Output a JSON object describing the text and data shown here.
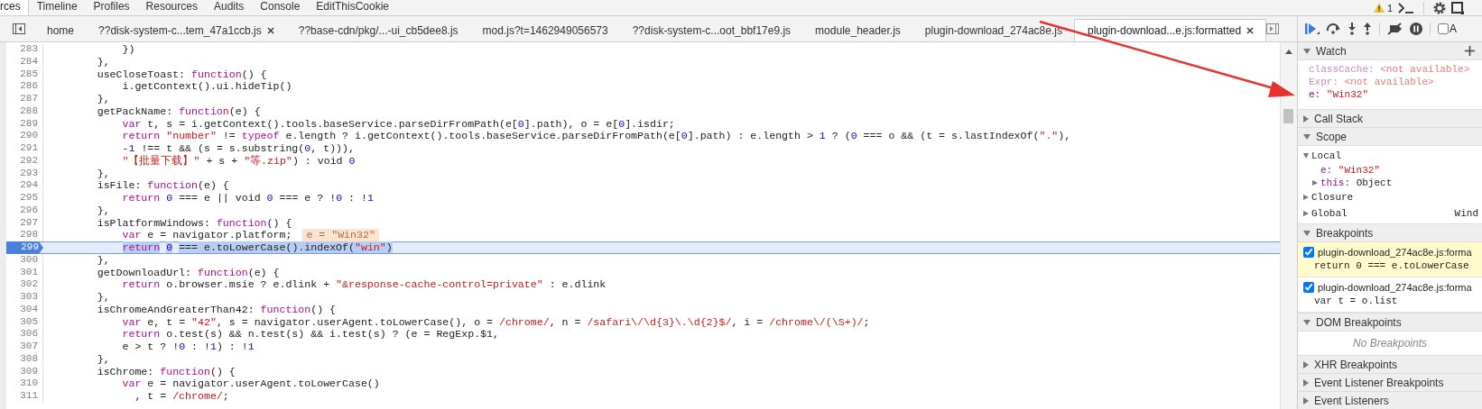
{
  "panel_tabs": [
    {
      "label": "rces",
      "selected": true
    },
    {
      "label": "Timeline",
      "selected": false
    },
    {
      "label": "Profiles",
      "selected": false
    },
    {
      "label": "Resources",
      "selected": false
    },
    {
      "label": "Audits",
      "selected": false
    },
    {
      "label": "Console",
      "selected": false
    },
    {
      "label": "EditThisCookie",
      "selected": false
    }
  ],
  "warnings": {
    "count": "1"
  },
  "file_tabs": [
    {
      "label": "home",
      "selected": false,
      "closable": false
    },
    {
      "label": "??disk-system-c...tem_47a1ccb.js",
      "selected": false,
      "closable": true
    },
    {
      "label": "??base-cdn/pkg/...-ui_cb5dee8.js",
      "selected": false,
      "closable": false
    },
    {
      "label": "mod.js?t=1462949056573",
      "selected": false,
      "closable": false
    },
    {
      "label": "??disk-system-c...oot_bbf17e9.js",
      "selected": false,
      "closable": false
    },
    {
      "label": "module_header.js",
      "selected": false,
      "closable": false
    },
    {
      "label": "plugin-download_274ac8e.js",
      "selected": false,
      "closable": false
    },
    {
      "label": "plugin-download...e.js:formatted",
      "selected": true,
      "closable": true
    }
  ],
  "debugger_toolbar": {
    "async_label": "A",
    "async_checked": false
  },
  "code": {
    "lines": [
      {
        "number": "283",
        "current": false,
        "selected": false,
        "tokens": [
          {
            "kind": "plain",
            "text": "            })"
          }
        ]
      },
      {
        "number": "284",
        "current": false,
        "selected": false,
        "tokens": [
          {
            "kind": "plain",
            "text": "        },"
          }
        ]
      },
      {
        "number": "285",
        "current": false,
        "selected": false,
        "tokens": [
          {
            "kind": "plain",
            "text": "        useCloseToast: "
          },
          {
            "kind": "keyword",
            "text": "function"
          },
          {
            "kind": "plain",
            "text": "() {"
          }
        ]
      },
      {
        "number": "286",
        "current": false,
        "selected": false,
        "tokens": [
          {
            "kind": "plain",
            "text": "            i.getContext().ui.hideTip()"
          }
        ]
      },
      {
        "number": "287",
        "current": false,
        "selected": false,
        "tokens": [
          {
            "kind": "plain",
            "text": "        },"
          }
        ]
      },
      {
        "number": "288",
        "current": false,
        "selected": false,
        "tokens": [
          {
            "kind": "plain",
            "text": "        getPackName: "
          },
          {
            "kind": "keyword",
            "text": "function"
          },
          {
            "kind": "plain",
            "text": "(e) {"
          }
        ]
      },
      {
        "number": "289",
        "current": false,
        "selected": false,
        "tokens": [
          {
            "kind": "keyword",
            "text": "            var"
          },
          {
            "kind": "plain",
            "text": " t, s = i.getContext().tools.baseService.parseDirFromPath(e["
          },
          {
            "kind": "number",
            "text": "0"
          },
          {
            "kind": "plain",
            "text": "].path), o = e["
          },
          {
            "kind": "number",
            "text": "0"
          },
          {
            "kind": "plain",
            "text": "].isdir;"
          }
        ]
      },
      {
        "number": "290",
        "current": false,
        "selected": false,
        "tokens": [
          {
            "kind": "keyword",
            "text": "            return"
          },
          {
            "kind": "string",
            "text": " \"number\""
          },
          {
            "kind": "plain",
            "text": " != "
          },
          {
            "kind": "keyword",
            "text": "typeof"
          },
          {
            "kind": "plain",
            "text": " e.length ? i.getContext().tools.baseService.parseDirFromPath(e["
          },
          {
            "kind": "number",
            "text": "0"
          },
          {
            "kind": "plain",
            "text": "].path) : e.length > "
          },
          {
            "kind": "number",
            "text": "1"
          },
          {
            "kind": "plain",
            "text": " ? ("
          },
          {
            "kind": "number",
            "text": "0"
          },
          {
            "kind": "plain",
            "text": " === o && (t = s.lastIndexOf("
          },
          {
            "kind": "string",
            "text": "\".\""
          },
          {
            "kind": "plain",
            "text": "),"
          }
        ]
      },
      {
        "number": "291",
        "current": false,
        "selected": false,
        "tokens": [
          {
            "kind": "number",
            "text": "            -1"
          },
          {
            "kind": "plain",
            "text": " !== t && (s = s.substring("
          },
          {
            "kind": "number",
            "text": "0"
          },
          {
            "kind": "plain",
            "text": ", t))),"
          }
        ]
      },
      {
        "number": "292",
        "current": false,
        "selected": false,
        "tokens": [
          {
            "kind": "string",
            "text": "            \"【批量下载】\""
          },
          {
            "kind": "plain",
            "text": " + s + "
          },
          {
            "kind": "string",
            "text": "\"等.zip\""
          },
          {
            "kind": "plain",
            "text": ") : void "
          },
          {
            "kind": "number",
            "text": "0"
          }
        ]
      },
      {
        "number": "293",
        "current": false,
        "selected": false,
        "tokens": [
          {
            "kind": "plain",
            "text": "        },"
          }
        ]
      },
      {
        "number": "294",
        "current": false,
        "selected": false,
        "tokens": [
          {
            "kind": "plain",
            "text": "        isFile: "
          },
          {
            "kind": "keyword",
            "text": "function"
          },
          {
            "kind": "plain",
            "text": "(e) {"
          }
        ]
      },
      {
        "number": "295",
        "current": false,
        "selected": false,
        "tokens": [
          {
            "kind": "keyword",
            "text": "            return"
          },
          {
            "kind": "number",
            "text": " 0"
          },
          {
            "kind": "plain",
            "text": " === e || void "
          },
          {
            "kind": "number",
            "text": "0"
          },
          {
            "kind": "plain",
            "text": " === e ? !"
          },
          {
            "kind": "number",
            "text": "0"
          },
          {
            "kind": "plain",
            "text": " : !"
          },
          {
            "kind": "number",
            "text": "1"
          }
        ]
      },
      {
        "number": "296",
        "current": false,
        "selected": false,
        "tokens": [
          {
            "kind": "plain",
            "text": "        },"
          }
        ]
      },
      {
        "number": "297",
        "current": false,
        "selected": false,
        "tokens": [
          {
            "kind": "plain",
            "text": "        isPlatformWindows: "
          },
          {
            "kind": "keyword",
            "text": "function"
          },
          {
            "kind": "plain",
            "text": "() {"
          }
        ]
      },
      {
        "number": "298",
        "current": false,
        "selected": false,
        "inline_value": "e = \"Win32\"",
        "tokens": [
          {
            "kind": "keyword",
            "text": "            var"
          },
          {
            "kind": "plain",
            "text": " e = navigator.platform;"
          }
        ]
      },
      {
        "number": "299",
        "current": true,
        "selected": true,
        "tokens": [
          {
            "kind": "keyword",
            "text": "            return"
          },
          {
            "kind": "number",
            "text": " 0"
          },
          {
            "kind": "plain",
            "text": " === e.toLowerCase().indexOf("
          },
          {
            "kind": "string",
            "text": "\"win\""
          },
          {
            "kind": "plain",
            "text": ")"
          }
        ]
      },
      {
        "number": "300",
        "current": false,
        "selected": false,
        "tokens": [
          {
            "kind": "plain",
            "text": "        },"
          }
        ]
      },
      {
        "number": "301",
        "current": false,
        "selected": false,
        "tokens": [
          {
            "kind": "plain",
            "text": "        getDownloadUrl: "
          },
          {
            "kind": "keyword",
            "text": "function"
          },
          {
            "kind": "plain",
            "text": "(e) {"
          }
        ]
      },
      {
        "number": "302",
        "current": false,
        "selected": false,
        "tokens": [
          {
            "kind": "keyword",
            "text": "            return"
          },
          {
            "kind": "plain",
            "text": " o.browser.msie ? e.dlink + "
          },
          {
            "kind": "string",
            "text": "\"&response-cache-control=private\""
          },
          {
            "kind": "plain",
            "text": " : e.dlink"
          }
        ]
      },
      {
        "number": "303",
        "current": false,
        "selected": false,
        "tokens": [
          {
            "kind": "plain",
            "text": "        },"
          }
        ]
      },
      {
        "number": "304",
        "current": false,
        "selected": false,
        "tokens": [
          {
            "kind": "plain",
            "text": "        isChromeAndGreaterThan42: "
          },
          {
            "kind": "keyword",
            "text": "function"
          },
          {
            "kind": "plain",
            "text": "() {"
          }
        ]
      },
      {
        "number": "305",
        "current": false,
        "selected": false,
        "tokens": [
          {
            "kind": "keyword",
            "text": "            var"
          },
          {
            "kind": "plain",
            "text": " e, t = "
          },
          {
            "kind": "string",
            "text": "\"42\""
          },
          {
            "kind": "plain",
            "text": ", s = navigator.userAgent.toLowerCase(), o = "
          },
          {
            "kind": "regex",
            "text": "/chrome/"
          },
          {
            "kind": "plain",
            "text": ", n = "
          },
          {
            "kind": "regex",
            "text": "/safari\\/\\d{3}\\.\\d{2}$/"
          },
          {
            "kind": "plain",
            "text": ", i = "
          },
          {
            "kind": "regex",
            "text": "/chrome\\/(\\S+)/"
          },
          {
            "kind": "plain",
            "text": ";"
          }
        ]
      },
      {
        "number": "306",
        "current": false,
        "selected": false,
        "tokens": [
          {
            "kind": "keyword",
            "text": "            return"
          },
          {
            "kind": "plain",
            "text": " o.test(s) && n.test(s) && i.test(s) ? (e = RegExp.$1,"
          }
        ]
      },
      {
        "number": "307",
        "current": false,
        "selected": false,
        "tokens": [
          {
            "kind": "plain",
            "text": "            e > t ? !"
          },
          {
            "kind": "number",
            "text": "0"
          },
          {
            "kind": "plain",
            "text": " : !"
          },
          {
            "kind": "number",
            "text": "1"
          },
          {
            "kind": "plain",
            "text": ") : !"
          },
          {
            "kind": "number",
            "text": "1"
          }
        ]
      },
      {
        "number": "308",
        "current": false,
        "selected": false,
        "tokens": [
          {
            "kind": "plain",
            "text": "        },"
          }
        ]
      },
      {
        "number": "309",
        "current": false,
        "selected": false,
        "tokens": [
          {
            "kind": "plain",
            "text": "        isChrome: "
          },
          {
            "kind": "keyword",
            "text": "function"
          },
          {
            "kind": "plain",
            "text": "() {"
          }
        ]
      },
      {
        "number": "310",
        "current": false,
        "selected": false,
        "tokens": [
          {
            "kind": "keyword",
            "text": "            var"
          },
          {
            "kind": "plain",
            "text": " e = navigator.userAgent.toLowerCase()"
          }
        ]
      },
      {
        "number": "311",
        "current": false,
        "selected": false,
        "tokens": [
          {
            "kind": "plain",
            "text": "              , t = "
          },
          {
            "kind": "regex",
            "text": "/chrome/"
          },
          {
            "kind": "plain",
            "text": ";"
          }
        ]
      }
    ]
  },
  "sidebar": {
    "sections": [
      {
        "kind": "watch",
        "title": "Watch",
        "expanded": true,
        "items": [
          {
            "name": "classCache:",
            "value": "<not available>",
            "available": false
          },
          {
            "name": "Expr:",
            "value": "<not available>",
            "available": false
          },
          {
            "name": "e:",
            "value": "\"Win32\"",
            "available": true
          }
        ]
      },
      {
        "kind": "plain",
        "title": "Call Stack",
        "expanded": false
      },
      {
        "kind": "scope",
        "title": "Scope",
        "expanded": true,
        "items": [
          {
            "name": "Local",
            "expanded": true,
            "children": [
              {
                "name": "e:",
                "value": "\"Win32\""
              },
              {
                "name": "this:",
                "value": "Object",
                "expanded": false
              }
            ]
          },
          {
            "name": "Closure",
            "expanded": false
          },
          {
            "name": "Global",
            "value": "Wind",
            "expanded": false
          }
        ]
      },
      {
        "kind": "breakpoints",
        "title": "Breakpoints",
        "expanded": true,
        "items": [
          {
            "file": "plugin-download_274ac8e.js:forma",
            "code": "return 0 === e.toLowerCase",
            "checked": true,
            "selected": true
          },
          {
            "file": "plugin-download_274ac8e.js:forma",
            "code": "var t = o.list",
            "checked": true,
            "selected": false
          }
        ]
      },
      {
        "kind": "empty",
        "title": "DOM Breakpoints",
        "expanded": true,
        "message": "No Breakpoints"
      },
      {
        "kind": "plain",
        "title": "XHR Breakpoints",
        "expanded": false
      },
      {
        "kind": "plain",
        "title": "Event Listener Breakpoints",
        "expanded": false
      },
      {
        "kind": "plain",
        "title": "Event Listeners",
        "expanded": false
      }
    ]
  }
}
